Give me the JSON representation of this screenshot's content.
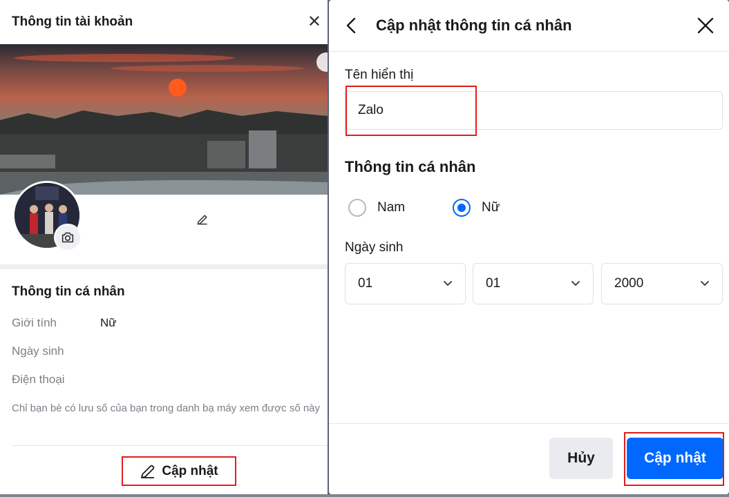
{
  "left_panel": {
    "title": "Thông tin tài khoản",
    "close_glyph": "✕",
    "info_section": {
      "title": "Thông tin cá nhân",
      "rows": [
        {
          "label": "Giới tính",
          "value": "Nữ"
        },
        {
          "label": "Ngày sinh",
          "value": ""
        },
        {
          "label": "Điện thoại",
          "value": ""
        }
      ],
      "note": "Chỉ bạn bè có lưu số của bạn trong danh bạ máy xem được số này"
    },
    "update_button": "Cập nhật",
    "icons": [
      "close-icon",
      "camera-icon",
      "pencil-icon",
      "edit-icon"
    ]
  },
  "right_panel": {
    "title": "Cập nhật thông tin cá nhân",
    "display_name_label": "Tên hiển thị",
    "display_name_value": "Zalo",
    "section_title": "Thông tin cá nhân",
    "gender": {
      "options": [
        "Nam",
        "Nữ"
      ],
      "selected": "Nữ"
    },
    "dob_label": "Ngày sinh",
    "dob": {
      "day": "01",
      "month": "01",
      "year": "2000"
    },
    "cancel_button": "Hủy",
    "submit_button": "Cập nhật",
    "icons": [
      "back-arrow-icon",
      "close-icon",
      "chevron-down-icon"
    ]
  },
  "colors": {
    "primary": "#0068ff",
    "highlight": "#e01c1c",
    "muted_text": "#7a7f86",
    "button_gray": "#e9ebee"
  }
}
